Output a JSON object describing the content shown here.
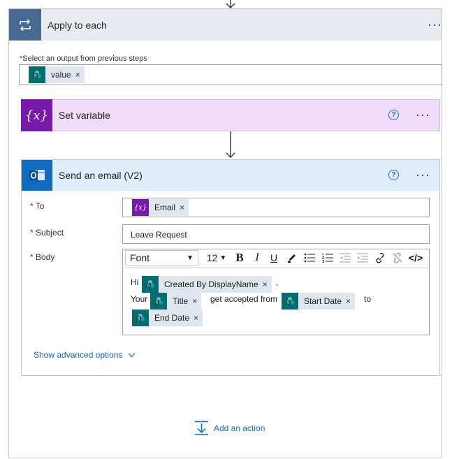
{
  "loop": {
    "title": "Apply to each",
    "more": "···",
    "select_label": "Select an output from previous steps",
    "required_mark": "*",
    "token": "value"
  },
  "set_variable": {
    "title": "Set variable",
    "help": "?",
    "more": "···"
  },
  "email": {
    "title": "Send an email (V2)",
    "help": "?",
    "more": "···",
    "to_label": "To",
    "to_token": "Email",
    "subject_label": "Subject",
    "subject_value": "Leave Request",
    "body_label": "Body",
    "toolbar": {
      "font": "Font",
      "size": "12",
      "bold": "B",
      "italic": "I",
      "underline": "U",
      "code": "</>"
    },
    "body": {
      "hi": "Hi",
      "comma": ",",
      "your": "Your",
      "get_accepted": "get accepted from",
      "to": "to",
      "tokens": {
        "created_by": "Created By DisplayName",
        "title": "Title",
        "start_date": "Start Date",
        "end_date": "End Date"
      }
    },
    "show_advanced": "Show advanced options"
  },
  "add_action": "Add an action",
  "token_remove": "×",
  "colors": {
    "loop": "#486991",
    "variable": "#7719aa",
    "variable_bg": "#eedcf8",
    "email_bg": "#dfecf9",
    "outlook": "#0f6cbd",
    "sharepoint": "#036c70"
  }
}
